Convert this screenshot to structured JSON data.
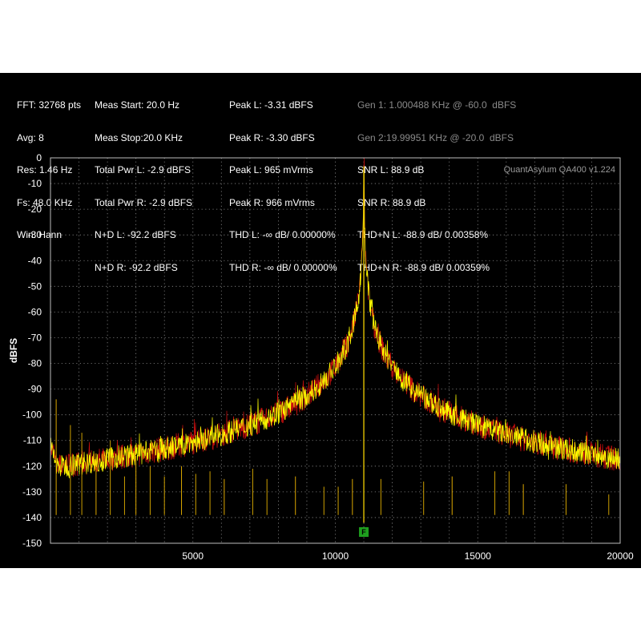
{
  "header": {
    "col1": [
      "FFT: 32768 pts",
      "Avg: 8",
      "Res: 1.46 Hz",
      "Fs: 48.0 KHz",
      "Win: Hann"
    ],
    "col2": [
      "Meas Start: 20.0 Hz",
      "Meas Stop:20.0 KHz",
      "Total Pwr L: -2.9 dBFS",
      "Total Pwr R: -2.9 dBFS",
      "N+D L: -92.2 dBFS",
      "N+D R: -92.2 dBFS"
    ],
    "col3": [
      "Peak L: -3.31 dBFS",
      "Peak R: -3.30 dBFS",
      "Peak L: 965 mVrms",
      "Peak R: 966 mVrms",
      "THD L: -∞ dB/ 0.00000%",
      "THD R: -∞ dB/ 0.00000%"
    ],
    "col4": [
      "Gen 1: 1.000488 KHz @ -60.0  dBFS",
      "Gen 2:19.99951 KHz @ -20.0  dBFS",
      "SNR L: 88.9 dB",
      "SNR R: 88.9 dB",
      "THD+N L: -88.9 dB/ 0.00358%",
      "THD+N R: -88.9 dB/ 0.00359%"
    ]
  },
  "watermark": "QuantAsylum QA400 v1.224",
  "marker_label": "F",
  "colors": {
    "background": "#000000",
    "grid": "#8c8c8c",
    "trace_left": "#ffff00",
    "trace_right": "#e01010",
    "marker": "#1e9e1e",
    "dim_text": "#8a8a8a"
  },
  "chart_data": {
    "type": "line",
    "title": "",
    "xlabel": "",
    "ylabel": "dBFS",
    "xlim": [
      0,
      20000
    ],
    "ylim": [
      -150,
      0
    ],
    "xticks": [
      "5000",
      "10000",
      "15000",
      "20000"
    ],
    "xtick_values": [
      5000,
      10000,
      15000,
      20000
    ],
    "yticks": [
      "0",
      "-10",
      "-20",
      "-30",
      "-40",
      "-50",
      "-60",
      "-70",
      "-80",
      "-90",
      "-100",
      "-110",
      "-120",
      "-130",
      "-140",
      "-150"
    ],
    "ytick_values": [
      0,
      -10,
      -20,
      -30,
      -40,
      -50,
      -60,
      -70,
      -80,
      -90,
      -100,
      -110,
      -120,
      -130,
      -140,
      -150
    ],
    "grid": true,
    "noise_floor": -142,
    "main_peak": {
      "frequency": 11000,
      "level": -3.3
    },
    "marker_frequency": 11000,
    "spurs": [
      {
        "frequency": 200,
        "level": -94
      },
      {
        "frequency": 700,
        "level": -104
      },
      {
        "frequency": 1100,
        "level": -107
      },
      {
        "frequency": 1600,
        "level": -115
      },
      {
        "frequency": 2100,
        "level": -110
      },
      {
        "frequency": 2600,
        "level": -124
      },
      {
        "frequency": 3000,
        "level": -116
      },
      {
        "frequency": 3500,
        "level": -120
      },
      {
        "frequency": 4000,
        "level": -124
      },
      {
        "frequency": 4600,
        "level": -120
      },
      {
        "frequency": 5100,
        "level": -123
      },
      {
        "frequency": 5600,
        "level": -122
      },
      {
        "frequency": 6100,
        "level": -125
      },
      {
        "frequency": 7100,
        "level": -121
      },
      {
        "frequency": 7600,
        "level": -125
      },
      {
        "frequency": 8600,
        "level": -124
      },
      {
        "frequency": 9600,
        "level": -128
      },
      {
        "frequency": 10100,
        "level": -128
      },
      {
        "frequency": 10600,
        "level": -125
      },
      {
        "frequency": 11600,
        "level": -125
      },
      {
        "frequency": 13100,
        "level": -126
      },
      {
        "frequency": 14100,
        "level": -124
      },
      {
        "frequency": 15600,
        "level": -122
      },
      {
        "frequency": 16100,
        "level": -122
      },
      {
        "frequency": 16600,
        "level": -127
      },
      {
        "frequency": 18100,
        "level": -127
      },
      {
        "frequency": 19600,
        "level": -131
      }
    ],
    "series": [
      {
        "name": "L",
        "color": "#ffff00"
      },
      {
        "name": "R",
        "color": "#e01010"
      }
    ]
  }
}
